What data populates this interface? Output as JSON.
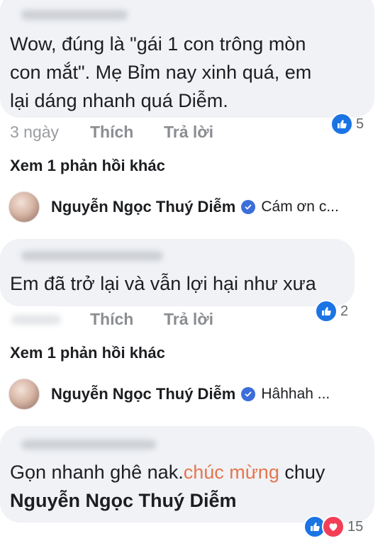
{
  "comments": [
    {
      "lines": [
        "Wow, đúng là \"gái 1 con trông mòn",
        "con mắt\". Mẹ Bỉm nay xinh quá, em",
        "lại dáng nhanh quá Diễm."
      ],
      "time": "3 ngày",
      "like_label": "Thích",
      "reply_label": "Trả lời",
      "reaction_count": "5",
      "view_more": "Xem 1 phản hồi khác",
      "reply": {
        "name": "Nguyễn Ngọc Thuý Diễm",
        "text": "Cám ơn c..."
      }
    },
    {
      "lines": [
        "Em đã trở lại và vẫn lợi hại như xưa"
      ],
      "like_label": "Thích",
      "reply_label": "Trả lời",
      "reaction_count": "2",
      "view_more": "Xem 1 phản hồi khác",
      "reply": {
        "name": "Nguyễn Ngọc Thuý Diễm",
        "text": "Hâhhah ..."
      }
    },
    {
      "line1_prefix": "Gọn nhanh ghê nak.",
      "line1_highlight": "chúc mừng",
      "line1_suffix": " chuy",
      "line2_mention": "Nguyễn Ngọc Thuý Diễm",
      "reaction_count": "15"
    }
  ],
  "colors": {
    "accent": "#e4764f",
    "like": "#1b74e4",
    "love": "#f33e58",
    "bubble": "#f0f2f5",
    "verified": "#3b6ddb"
  },
  "icons": {
    "like": "thumbs-up-icon",
    "love": "heart-icon",
    "verified": "check-badge-icon"
  }
}
